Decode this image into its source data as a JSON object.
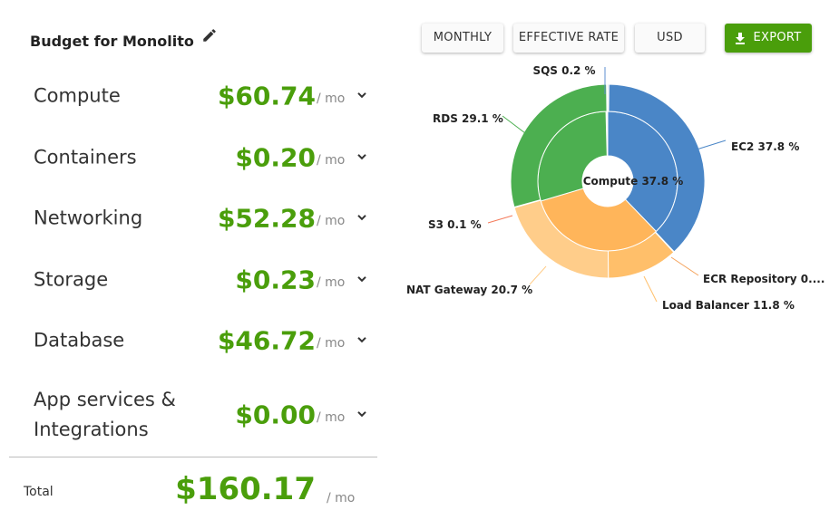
{
  "budget": {
    "title": "Budget for Monolito",
    "edit_icon": "pencil-icon",
    "rows": [
      {
        "label": "Compute",
        "amount": "$60.74",
        "unit": "/ mo"
      },
      {
        "label": "Containers",
        "amount": "$0.20",
        "unit": "/ mo"
      },
      {
        "label": "Networking",
        "amount": "$52.28",
        "unit": "/ mo"
      },
      {
        "label": "Storage",
        "amount": "$0.23",
        "unit": "/ mo"
      },
      {
        "label": "Database",
        "amount": "$46.72",
        "unit": "/ mo"
      },
      {
        "label": "App services & Integrations",
        "amount": "$0.00",
        "unit": "/ mo"
      }
    ],
    "total_label": "Total",
    "total_amount": "$160.17",
    "total_unit": "/ mo"
  },
  "toolbar": {
    "monthly": "MONTHLY",
    "effective_rate": "EFFECTIVE RATE",
    "currency": "USD",
    "export": "EXPORT",
    "export_icon": "download-icon"
  },
  "colors": {
    "accent_green": "#4a9e0b",
    "blue": "#4a86c7",
    "green": "#4caf50",
    "orange": "#ffb55a",
    "light_orange": "#ffcd8a"
  },
  "chart_data": {
    "type": "pie",
    "inner_ring": [
      {
        "label": "Compute",
        "percent": 37.8
      },
      {
        "label": "Networking",
        "percent": 32.6
      },
      {
        "label": "Database",
        "percent": 29.2
      }
    ],
    "outer_ring": [
      {
        "label": "SQS 0.2 %",
        "percent": 0.2
      },
      {
        "label": "EC2 37.8 %",
        "percent": 37.8
      },
      {
        "label": "ECR Repository 0....",
        "percent": 0.1
      },
      {
        "label": "Load Balancer 11.8 %",
        "percent": 11.8
      },
      {
        "label": "NAT Gateway 20.7 %",
        "percent": 20.7
      },
      {
        "label": "S3 0.1 %",
        "percent": 0.1
      },
      {
        "label": "RDS 29.1 %",
        "percent": 29.1
      }
    ],
    "center_label": "Compute 37.8 %"
  }
}
